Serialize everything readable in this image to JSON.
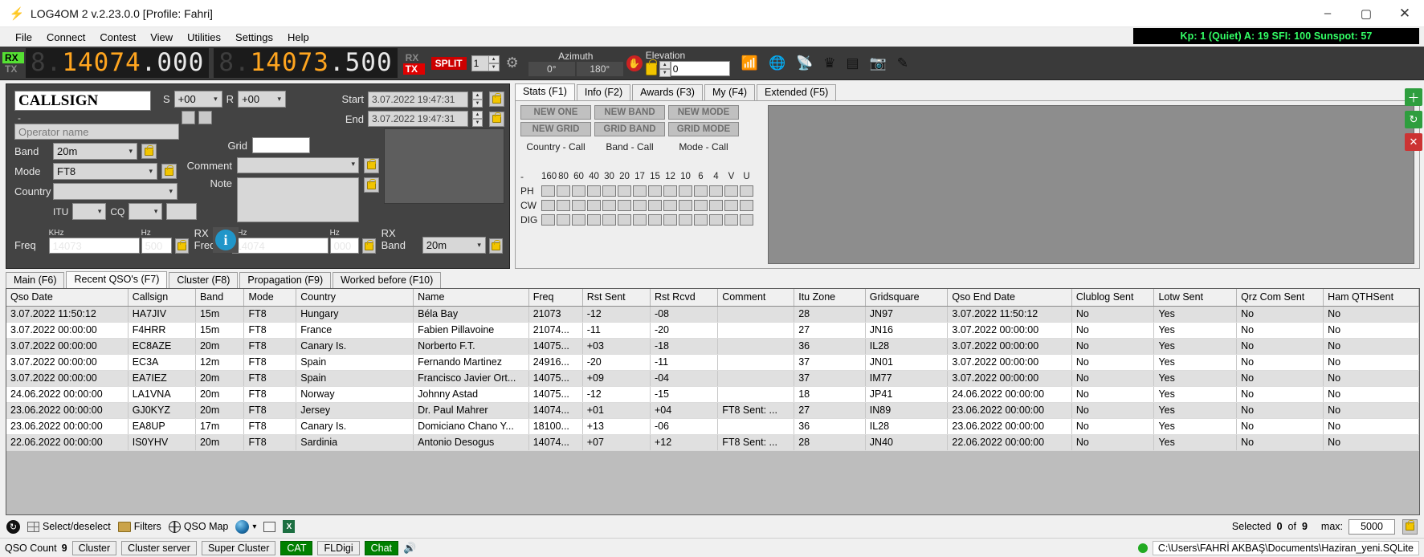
{
  "window": {
    "title": "LOG4OM 2 v.2.23.0.0 [Profile: Fahri]",
    "logo_icon": "log4om-logo-icon",
    "minimize": "–",
    "maximize": "▢",
    "close": "✕"
  },
  "menu": {
    "items": [
      "File",
      "Connect",
      "Contest",
      "View",
      "Utilities",
      "Settings",
      "Help"
    ],
    "solar": "Kp: 1 (Quiet)  A: 19  SFI: 100 Sunspot: 57"
  },
  "radiobar": {
    "rx_label": "RX",
    "tx_label": "TX",
    "vfo_a": {
      "lead": "8.",
      "amber": "14074",
      "white": ".000"
    },
    "vfo_b": {
      "lead": "8.",
      "amber": "14073",
      "white": ".500"
    },
    "rx2_label": "RX",
    "tx2_label": "TX",
    "split_label": "SPLIT",
    "radio_number": "1",
    "gear_icon": "gear-icon",
    "azimuth_label": "Azimuth",
    "azimuth_value": "0°",
    "azimuth_value2": "180°",
    "stop_icon": "stop-hand-icon",
    "elevation_label": "Elevation",
    "elevation_value": "0",
    "lock_icon": "padlock-icon",
    "tool_icons": [
      "signal-icon",
      "globe-icon",
      "antenna-icon",
      "crown-icon",
      "server-icon",
      "camera-icon",
      "pencil-icon"
    ]
  },
  "qso": {
    "callsign_placeholder": "CALLSIGN",
    "callsign_value": "",
    "dash": "-",
    "operator_placeholder": "Operator name",
    "band_label": "Band",
    "band_value": "20m",
    "mode_label": "Mode",
    "mode_value": "FT8",
    "country_label": "Country",
    "country_value": "",
    "itu_label": "ITU",
    "itu_value": "",
    "cq_label": "CQ",
    "cq_value": "",
    "cq_extra": "",
    "freq_label": "Freq",
    "freq_khz_label": "KHz",
    "freq_khz": "14073",
    "freq_hz_label": "Hz",
    "freq_hz": "500",
    "rxfreq_label": "RX Freq",
    "rxfreq_khz_label": "KHz",
    "rxfreq_khz": "14074",
    "rxfreq_hz_label": "Hz",
    "rxfreq_hz": "000",
    "rxband_label": "RX Band",
    "rxband_value": "20m",
    "s_label": "S",
    "s_value": "+00",
    "r_label": "R",
    "r_value": "+00",
    "grid_label": "Grid",
    "grid_value": "",
    "comment_label": "Comment",
    "comment_value": "",
    "note_label": "Note",
    "note_value": "",
    "start_label": "Start",
    "start_value": "3.07.2022 19:47:31",
    "end_label": "End",
    "end_value": "3.07.2022 19:47:31",
    "info_icon": "info-icon",
    "lock_icon": "padlock-icon"
  },
  "stats": {
    "tabs": [
      {
        "label": "Stats (F1)",
        "active": true
      },
      {
        "label": "Info (F2)",
        "active": false
      },
      {
        "label": "Awards (F3)",
        "active": false
      },
      {
        "label": "My (F4)",
        "active": false
      },
      {
        "label": "Extended (F5)",
        "active": false
      }
    ],
    "buttons": [
      {
        "top": "NEW ONE",
        "bottom": "NEW GRID",
        "caption": "Country - Call"
      },
      {
        "top": "NEW BAND",
        "bottom": "GRID BAND",
        "caption": "Band - Call"
      },
      {
        "top": "NEW MODE",
        "bottom": "GRID MODE",
        "caption": "Mode - Call"
      }
    ],
    "band_header_dash": "-",
    "band_headers": [
      "160",
      "80",
      "60",
      "40",
      "30",
      "20",
      "17",
      "15",
      "12",
      "10",
      "6",
      "4",
      "V",
      "U"
    ],
    "mode_rows": [
      "PH",
      "CW",
      "DIG"
    ]
  },
  "lower_tabs": [
    {
      "label": "Main (F6)",
      "active": false
    },
    {
      "label": "Recent QSO's (F7)",
      "active": true
    },
    {
      "label": "Cluster (F8)",
      "active": false
    },
    {
      "label": "Propagation (F9)",
      "active": false
    },
    {
      "label": "Worked before (F10)",
      "active": false
    }
  ],
  "table": {
    "columns": [
      "Qso Date",
      "Callsign",
      "Band",
      "Mode",
      "Country",
      "Name",
      "Freq",
      "Rst Sent",
      "Rst Rcvd",
      "Comment",
      "Itu Zone",
      "Gridsquare",
      "Qso End Date",
      "Clublog Sent",
      "Lotw Sent",
      "Qrz Com Sent",
      "Ham QTHSent"
    ],
    "rows": [
      [
        "3.07.2022 11:50:12",
        "HA7JIV",
        "15m",
        "FT8",
        "Hungary",
        "Béla Bay",
        "21073",
        "-12",
        "-08",
        "",
        "28",
        "JN97",
        "3.07.2022 11:50:12",
        "No",
        "Yes",
        "No",
        "No"
      ],
      [
        "3.07.2022 00:00:00",
        "F4HRR",
        "15m",
        "FT8",
        "France",
        "Fabien Pillavoine",
        "21074...",
        "-11",
        "-20",
        "",
        "27",
        "JN16",
        "3.07.2022 00:00:00",
        "No",
        "Yes",
        "No",
        "No"
      ],
      [
        "3.07.2022 00:00:00",
        "EC8AZE",
        "20m",
        "FT8",
        "Canary Is.",
        "Norberto F.T.",
        "14075...",
        "+03",
        "-18",
        "",
        "36",
        "IL28",
        "3.07.2022 00:00:00",
        "No",
        "Yes",
        "No",
        "No"
      ],
      [
        "3.07.2022 00:00:00",
        "EC3A",
        "12m",
        "FT8",
        "Spain",
        "Fernando Martinez",
        "24916...",
        "-20",
        "-11",
        "",
        "37",
        "JN01",
        "3.07.2022 00:00:00",
        "No",
        "Yes",
        "No",
        "No"
      ],
      [
        "3.07.2022 00:00:00",
        "EA7IEZ",
        "20m",
        "FT8",
        "Spain",
        "Francisco Javier Ort...",
        "14075...",
        "+09",
        "-04",
        "",
        "37",
        "IM77",
        "3.07.2022 00:00:00",
        "No",
        "Yes",
        "No",
        "No"
      ],
      [
        "24.06.2022 00:00:00",
        "LA1VNA",
        "20m",
        "FT8",
        "Norway",
        "Johnny Astad",
        "14075...",
        "-12",
        "-15",
        "",
        "18",
        "JP41",
        "24.06.2022 00:00:00",
        "No",
        "Yes",
        "No",
        "No"
      ],
      [
        "23.06.2022 00:00:00",
        "GJ0KYZ",
        "20m",
        "FT8",
        "Jersey",
        "Dr. Paul Mahrer",
        "14074...",
        "+01",
        "+04",
        "FT8  Sent: ...",
        "27",
        "IN89",
        "23.06.2022 00:00:00",
        "No",
        "Yes",
        "No",
        "No"
      ],
      [
        "23.06.2022 00:00:00",
        "EA8UP",
        "17m",
        "FT8",
        "Canary Is.",
        "Domiciano Chano Y...",
        "18100...",
        "+13",
        "-06",
        "",
        "36",
        "IL28",
        "23.06.2022 00:00:00",
        "No",
        "Yes",
        "No",
        "No"
      ],
      [
        "22.06.2022 00:00:00",
        "IS0YHV",
        "20m",
        "FT8",
        "Sardinia",
        "Antonio Desogus",
        "14074...",
        "+07",
        "+12",
        "FT8  Sent: ...",
        "28",
        "JN40",
        "22.06.2022 00:00:00",
        "No",
        "Yes",
        "No",
        "No"
      ]
    ]
  },
  "bottom_toolbar": {
    "refresh_icon": "refresh-icon",
    "select_icon": "select-deselect-icon",
    "select_label": "Select/deselect",
    "filters_icon": "filters-icon",
    "filters_label": "Filters",
    "qsomap_icon": "qso-map-icon",
    "qsomap_label": "QSO Map",
    "earth_icon": "google-earth-icon",
    "dropdown_caret": "▾",
    "window_icon": "window-icon",
    "excel_icon": "excel-export-icon",
    "selected_label": "Selected",
    "selected_count": "0",
    "selected_of": "of",
    "selected_total": "9",
    "max_label": "max:",
    "max_value": "5000",
    "lock_icon": "padlock-icon"
  },
  "statusbar": {
    "qso_count_label": "QSO Count",
    "qso_count": "9",
    "buttons": [
      {
        "label": "Cluster",
        "green": false
      },
      {
        "label": "Cluster server",
        "green": false
      },
      {
        "label": "Super Cluster",
        "green": false
      },
      {
        "label": "CAT",
        "green": true
      },
      {
        "label": "FLDigi",
        "green": false
      },
      {
        "label": "Chat",
        "green": true
      }
    ],
    "speaker_icon": "speaker-icon",
    "db_icon": "database-status-icon",
    "db_path": "C:\\Users\\FAHRİ AKBAŞ\\Documents\\Haziran_yeni.SQLite"
  },
  "sidebuttons": [
    {
      "icon": "add-icon",
      "color": "#2e9e3e"
    },
    {
      "icon": "refresh-icon",
      "color": "#2e9e3e"
    },
    {
      "icon": "clear-icon",
      "color": "#cc3333"
    }
  ],
  "colors": {
    "amber": "#ffa51f",
    "dark_panel": "#434343",
    "accent_green": "#33ff66",
    "split_red": "#cc0000"
  }
}
